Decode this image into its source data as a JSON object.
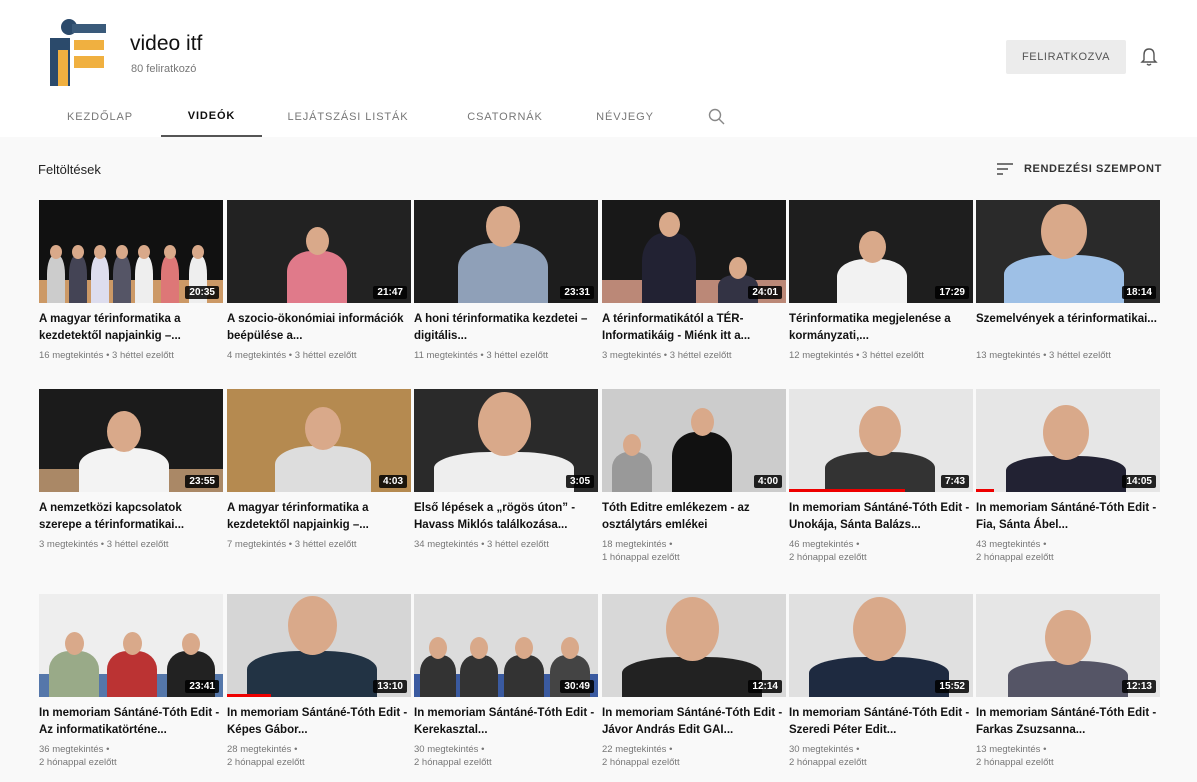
{
  "channel": {
    "name": "video itf",
    "subscribers": "80 feliratkozó",
    "subscribe_label": "FELIRATKOZVA"
  },
  "tabs": [
    {
      "label": "KEZDŐLAP",
      "active": false
    },
    {
      "label": "VIDEÓK",
      "active": true
    },
    {
      "label": "LEJÁTSZÁSI LISTÁK",
      "active": false
    },
    {
      "label": "CSATORNÁK",
      "active": false
    },
    {
      "label": "NÉVJEGY",
      "active": false
    }
  ],
  "section": {
    "title": "Feltöltések",
    "sort_label": "RENDEZÉSI SZEMPONT"
  },
  "videos": [
    {
      "title": "A magyar térinformatika a kezdetektől napjainkig –...",
      "views": "16 megtekintés",
      "age": "3 héttel ezelőtt",
      "duration": "20:35",
      "progress": 0
    },
    {
      "title": "A szocio-ökonómiai információk beépülése a...",
      "views": "4 megtekintés",
      "age": "3 héttel ezelőtt",
      "duration": "21:47",
      "progress": 0
    },
    {
      "title": "A honi térinformatika kezdetei – digitális...",
      "views": "11 megtekintés",
      "age": "3 héttel ezelőtt",
      "duration": "23:31",
      "progress": 0
    },
    {
      "title": "A térinformatikától a TÉR-Informatikáig - Miénk itt a...",
      "views": "3 megtekintés",
      "age": "3 héttel ezelőtt",
      "duration": "24:01",
      "progress": 0
    },
    {
      "title": "Térinformatika megjelenése a kormányzati,...",
      "views": "12 megtekintés",
      "age": "3 héttel ezelőtt",
      "duration": "17:29",
      "progress": 0
    },
    {
      "title": "Szemelvények a térinformatikai...",
      "views": "13 megtekintés",
      "age": "3 héttel ezelőtt",
      "duration": "18:14",
      "progress": 0
    },
    {
      "title": "A nemzetközi kapcsolatok szerepe a térinformatikai...",
      "views": "3 megtekintés",
      "age": "3 héttel ezelőtt",
      "duration": "23:55",
      "progress": 0
    },
    {
      "title": "A magyar térinformatika a kezdetektől napjainkig –...",
      "views": "7 megtekintés",
      "age": "3 héttel ezelőtt",
      "duration": "4:03",
      "progress": 0
    },
    {
      "title": "Első lépések a „rögös úton” - Havass Miklós találkozása...",
      "views": "34 megtekintés",
      "age": "3 héttel ezelőtt",
      "duration": "3:05",
      "progress": 0
    },
    {
      "title": "Tóth Editre emlékezem - az osztálytárs emlékei",
      "views": "18 megtekintés",
      "age": "1 hónappal ezelőtt",
      "duration": "4:00",
      "progress": 0
    },
    {
      "title": "In memoriam Sántáné-Tóth Edit - Unokája, Sánta Balázs...",
      "views": "46 megtekintés",
      "age": "2 hónappal ezelőtt",
      "duration": "7:43",
      "progress": 0.63
    },
    {
      "title": "In memoriam Sántáné-Tóth Edit - Fia, Sánta Ábel...",
      "views": "43 megtekintés",
      "age": "2 hónappal ezelőtt",
      "duration": "14:05",
      "progress": 0.1
    },
    {
      "title": "In memoriam Sántáné-Tóth Edit - Az informatikatörténe...",
      "views": "36 megtekintés",
      "age": "2 hónappal ezelőtt",
      "duration": "23:41",
      "progress": 0
    },
    {
      "title": "In memoriam Sántáné-Tóth Edit - Képes Gábor...",
      "views": "28 megtekintés",
      "age": "2 hónappal ezelőtt",
      "duration": "13:10",
      "progress": 0.24
    },
    {
      "title": "In memoriam Sántáné-Tóth Edit - Kerekasztal...",
      "views": "30 megtekintés",
      "age": "2 hónappal ezelőtt",
      "duration": "30:49",
      "progress": 0
    },
    {
      "title": "In memoriam Sántáné-Tóth Edit - Jávor András Edit GAI...",
      "views": "22 megtekintés",
      "age": "2 hónappal ezelőtt",
      "duration": "12:14",
      "progress": 0
    },
    {
      "title": "In memoriam Sántáné-Tóth Edit - Szeredi Péter Edit...",
      "views": "30 megtekintés",
      "age": "2 hónappal ezelőtt",
      "duration": "15:52",
      "progress": 0
    },
    {
      "title": "In memoriam Sántáné-Tóth Edit - Farkas Zsuzsanna...",
      "views": "13 megtekintés",
      "age": "2 hónappal ezelőtt",
      "duration": "12:13",
      "progress": 0
    }
  ],
  "icons": {
    "search": "search-icon",
    "bell": "bell-icon",
    "sort": "sort-icon",
    "logo": "channel-logo"
  },
  "colors": {
    "progress": "#ee0000",
    "page_background": "#f9f9f9",
    "header_background": "#ffffff"
  }
}
